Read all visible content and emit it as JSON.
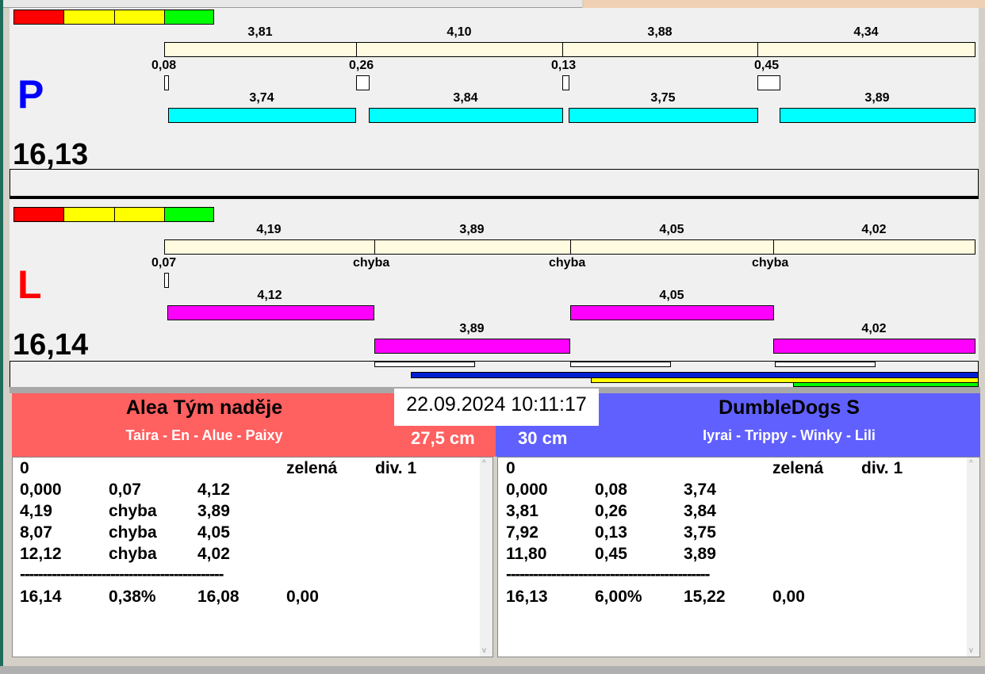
{
  "top": {
    "letter": "P",
    "total": "16,13",
    "segments": [
      "3,81",
      "4,10",
      "3,88",
      "4,34"
    ],
    "gaps": [
      "0,08",
      "0,26",
      "0,13",
      "0,45"
    ],
    "runs": [
      "3,74",
      "3,84",
      "3,75",
      "3,89"
    ]
  },
  "bottom": {
    "letter": "L",
    "total": "16,14",
    "segments": [
      "4,19",
      "3,89",
      "4,05",
      "4,02"
    ],
    "gaps": [
      "0,07",
      "chyba",
      "chyba",
      "chyba"
    ],
    "runs": [
      "4,12",
      "3,89",
      "4,05",
      "4,02"
    ]
  },
  "datetime": "22.09.2024 10:11:17",
  "left_team": {
    "name": "Alea Tým naděje",
    "dogs": "Taira - En - Alue - Paixy",
    "height": "27,5 cm",
    "color": "#ff6060",
    "rows": [
      [
        "0",
        "",
        "",
        "zelená",
        "div. 1"
      ],
      [
        "0,000",
        "0,07",
        "4,12"
      ],
      [
        "4,19",
        "chyba",
        "3,89"
      ],
      [
        "8,07",
        "chyba",
        "4,05"
      ],
      [
        "12,12",
        "chyba",
        "4,02"
      ]
    ],
    "separator": "---------------------------------------------",
    "summary": [
      "16,14",
      "0,38%",
      "16,08",
      "0,00"
    ]
  },
  "right_team": {
    "name": "DumbleDogs S",
    "dogs": "Iyrai - Trippy - Winky - Lili",
    "height": "30 cm",
    "color": "#6060ff",
    "rows": [
      [
        "0",
        "",
        "",
        "zelená",
        "div. 1"
      ],
      [
        "0,000",
        "0,08",
        "3,74"
      ],
      [
        "3,81",
        "0,26",
        "3,84"
      ],
      [
        "7,92",
        "0,13",
        "3,75"
      ],
      [
        "11,80",
        "0,45",
        "3,89"
      ]
    ],
    "separator": "---------------------------------------------",
    "summary": [
      "16,13",
      "6,00%",
      "15,22",
      "0,00"
    ]
  }
}
